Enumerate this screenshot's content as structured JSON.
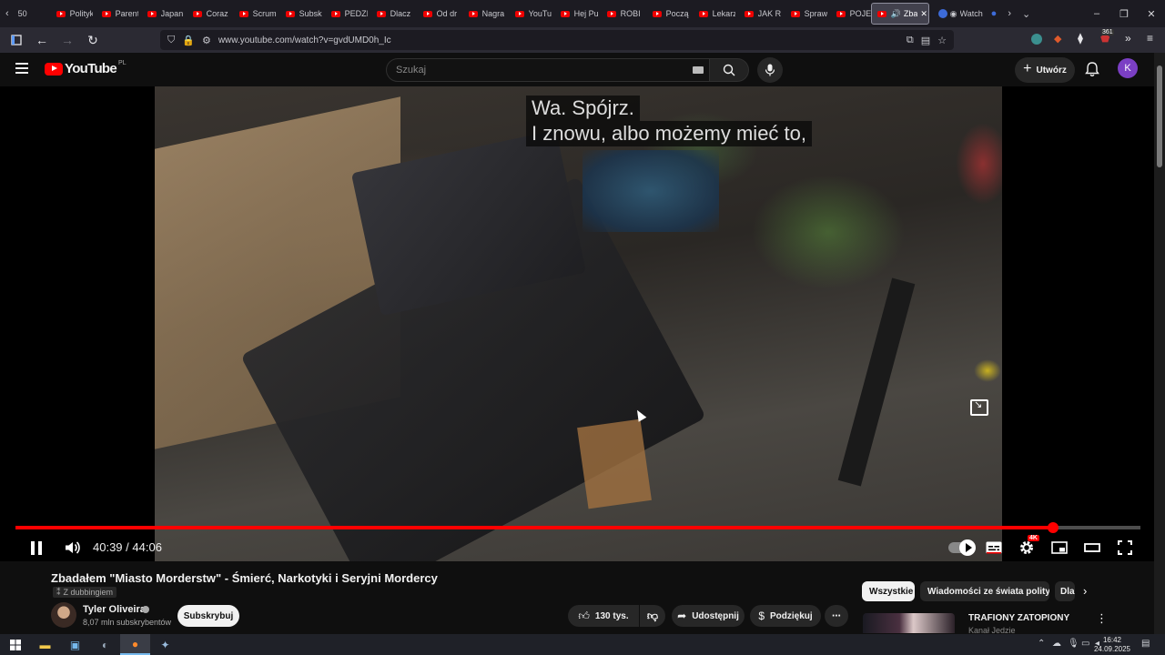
{
  "browser": {
    "tabs": [
      {
        "label": "50"
      },
      {
        "label": "Polityka"
      },
      {
        "label": "Parent"
      },
      {
        "label": "Japan"
      },
      {
        "label": "Coraz"
      },
      {
        "label": "Scrum"
      },
      {
        "label": "Subsk"
      },
      {
        "label": "PEDZI"
      },
      {
        "label": "Dlacz"
      },
      {
        "label": "Od dr"
      },
      {
        "label": "Nagra"
      },
      {
        "label": "YouTu"
      },
      {
        "label": "Hej Pu"
      },
      {
        "label": "ROBI"
      },
      {
        "label": "Począ"
      },
      {
        "label": "Lekarz"
      },
      {
        "label": "JAK R"
      },
      {
        "label": "Spraw"
      },
      {
        "label": "POJEC"
      },
      {
        "label": "Zba"
      },
      {
        "label": "Watch"
      }
    ],
    "url": "www.youtube.com/watch?v=gvdUMD0h_Ic",
    "extension_badge": "361"
  },
  "youtube": {
    "logo_text": "YouTube",
    "country_code": "PL",
    "search_placeholder": "Szukaj",
    "create_label": "Utwórz",
    "avatar_letter": "K"
  },
  "player": {
    "subtitle_line1": "Wa.  Spójrz.",
    "subtitle_line2": "I znowu, albo możemy mieć to,",
    "current_time": "40:39",
    "separator": " / ",
    "duration": "44:06",
    "progress_fraction": 0.922,
    "quality_badge": "4K"
  },
  "video_info": {
    "title": "Zbadałem \"Miasto Morderstw\" - Śmierć, Narkotyki i Seryjni Mordercy",
    "dub_label": "Z dubbingiem",
    "channel_name": "Tyler Oliveira",
    "subscribers": "8,07 mln subskrybentów",
    "subscribe_label": "Subskrybuj",
    "likes": "130 tys.",
    "share_label": "Udostępnij",
    "thanks_label": "Podziękuj"
  },
  "sidebar": {
    "chips": [
      "Wszystkie",
      "Wiadomości ze świata polityki",
      "Dla"
    ],
    "rec_title": "TRAFIONY ZATOPIONY",
    "rec_channel": "Kanał Jedzie"
  },
  "taskbar": {
    "time": "16:42",
    "date": "24.09.2025"
  },
  "colors": {
    "accent": "#ff0000",
    "background": "#0f0f0f"
  }
}
